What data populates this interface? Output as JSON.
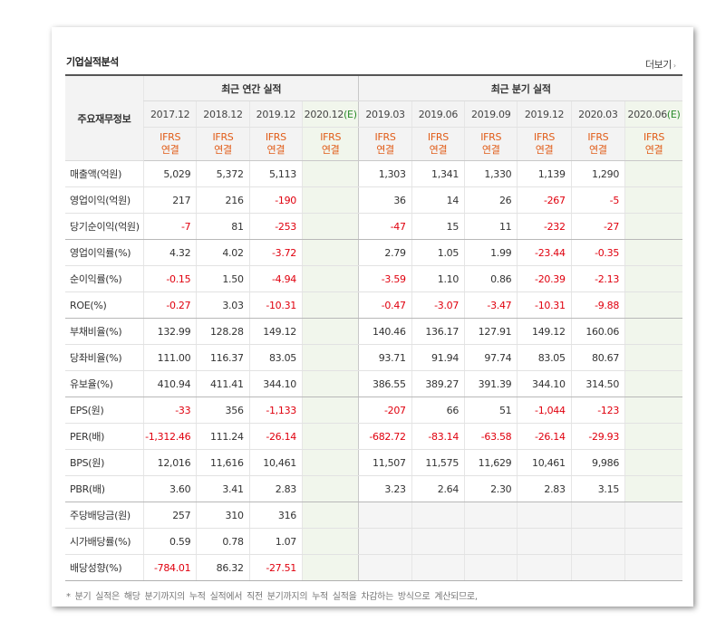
{
  "section_title": "기업실적분석",
  "more_label": "더보기",
  "more_arrow": "›",
  "header": {
    "row_label": "주요재무정보",
    "annual_group": "최근 연간 실적",
    "quarter_group": "최근 분기 실적",
    "annual_periods": [
      "2017.12",
      "2018.12",
      "2019.12",
      "2020.12"
    ],
    "annual_estimate_mark": "(E)",
    "quarter_periods": [
      "2019.03",
      "2019.06",
      "2019.09",
      "2019.12",
      "2020.03",
      "2020.06"
    ],
    "quarter_estimate_mark": "(E)",
    "basis_top": "IFRS",
    "basis_bottom": "연결"
  },
  "rows": [
    {
      "label": "매출액(억원)",
      "annual": [
        "5,029",
        "5,372",
        "5,113",
        ""
      ],
      "quarter": [
        "1,303",
        "1,341",
        "1,330",
        "1,139",
        "1,290",
        ""
      ]
    },
    {
      "label": "영업이익(억원)",
      "annual": [
        "217",
        "216",
        "-190",
        ""
      ],
      "quarter": [
        "36",
        "14",
        "26",
        "-267",
        "-5",
        ""
      ]
    },
    {
      "label": "당기순이익(억원)",
      "annual": [
        "-7",
        "81",
        "-253",
        ""
      ],
      "quarter": [
        "-47",
        "15",
        "11",
        "-232",
        "-27",
        ""
      ]
    },
    {
      "label": "영업이익률(%)",
      "annual": [
        "4.32",
        "4.02",
        "-3.72",
        ""
      ],
      "quarter": [
        "2.79",
        "1.05",
        "1.99",
        "-23.44",
        "-0.35",
        ""
      ]
    },
    {
      "label": "순이익률(%)",
      "annual": [
        "-0.15",
        "1.50",
        "-4.94",
        ""
      ],
      "quarter": [
        "-3.59",
        "1.10",
        "0.86",
        "-20.39",
        "-2.13",
        ""
      ]
    },
    {
      "label": "ROE(%)",
      "annual": [
        "-0.27",
        "3.03",
        "-10.31",
        ""
      ],
      "quarter": [
        "-0.47",
        "-3.07",
        "-3.47",
        "-10.31",
        "-9.88",
        ""
      ]
    },
    {
      "label": "부채비율(%)",
      "annual": [
        "132.99",
        "128.28",
        "149.12",
        ""
      ],
      "quarter": [
        "140.46",
        "136.17",
        "127.91",
        "149.12",
        "160.06",
        ""
      ]
    },
    {
      "label": "당좌비율(%)",
      "annual": [
        "111.00",
        "116.37",
        "83.05",
        ""
      ],
      "quarter": [
        "93.71",
        "91.94",
        "97.74",
        "83.05",
        "80.67",
        ""
      ]
    },
    {
      "label": "유보율(%)",
      "annual": [
        "410.94",
        "411.41",
        "344.10",
        ""
      ],
      "quarter": [
        "386.55",
        "389.27",
        "391.39",
        "344.10",
        "314.50",
        ""
      ]
    },
    {
      "label": "EPS(원)",
      "annual": [
        "-33",
        "356",
        "-1,133",
        ""
      ],
      "quarter": [
        "-207",
        "66",
        "51",
        "-1,044",
        "-123",
        ""
      ]
    },
    {
      "label": "PER(배)",
      "annual": [
        "-1,312.46",
        "111.24",
        "-26.14",
        ""
      ],
      "quarter": [
        "-682.72",
        "-83.14",
        "-63.58",
        "-26.14",
        "-29.93",
        ""
      ]
    },
    {
      "label": "BPS(원)",
      "annual": [
        "12,016",
        "11,616",
        "10,461",
        ""
      ],
      "quarter": [
        "11,507",
        "11,575",
        "11,629",
        "10,461",
        "9,986",
        ""
      ]
    },
    {
      "label": "PBR(배)",
      "annual": [
        "3.60",
        "3.41",
        "2.83",
        ""
      ],
      "quarter": [
        "3.23",
        "2.64",
        "2.30",
        "2.83",
        "3.15",
        ""
      ]
    },
    {
      "label": "주당배당금(원)",
      "annual": [
        "257",
        "310",
        "316",
        ""
      ],
      "quarter": [
        "",
        "",
        "",
        "",
        "",
        ""
      ]
    },
    {
      "label": "시가배당률(%)",
      "annual": [
        "0.59",
        "0.78",
        "1.07",
        ""
      ],
      "quarter": [
        "",
        "",
        "",
        "",
        "",
        ""
      ]
    },
    {
      "label": "배당성향(%)",
      "annual": [
        "-784.01",
        "86.32",
        "-27.51",
        ""
      ],
      "quarter": [
        "",
        "",
        "",
        "",
        "",
        ""
      ]
    }
  ],
  "footnote": "* 분기 실적은 해당 분기까지의 누적 실적에서 직전 분기까지의 누적 실적을 차감하는 방식으로 계산되므로,",
  "colors": {
    "negative": "#e0000e",
    "basis": "#e15c18",
    "estimate_bg": "#f1f6ec",
    "estimate_mark": "#2a8a2a"
  }
}
